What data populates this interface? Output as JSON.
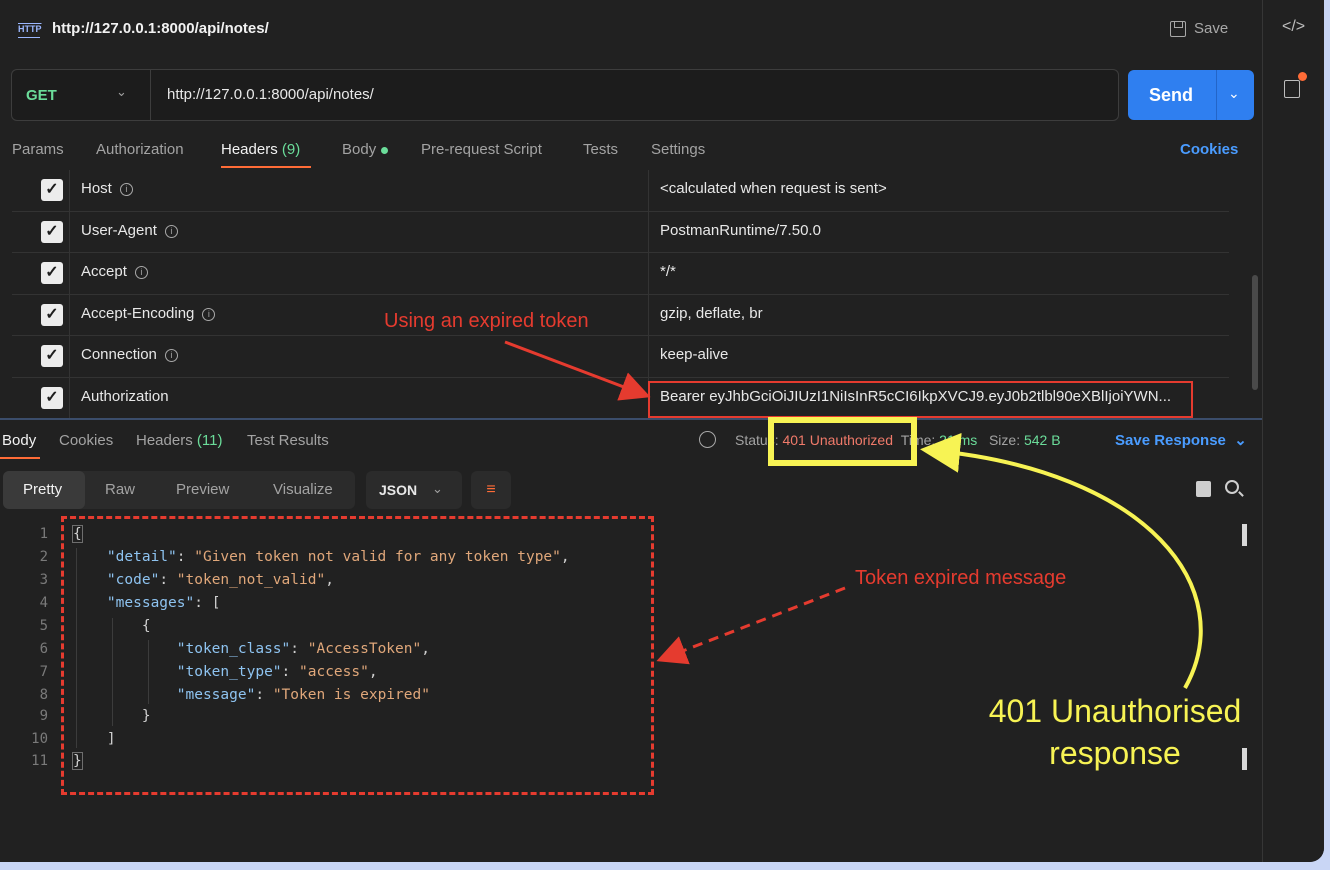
{
  "title_bar": {
    "protocol_badge": "HTTP",
    "title": "http://127.0.0.1:8000/api/notes/",
    "save_label": "Save"
  },
  "request": {
    "method": "GET",
    "url": "http://127.0.0.1:8000/api/notes/",
    "send_label": "Send"
  },
  "request_tabs": [
    {
      "label": "Params"
    },
    {
      "label": "Authorization"
    },
    {
      "label": "Headers",
      "count": "(9)",
      "active": true
    },
    {
      "label": "Body"
    },
    {
      "label": "Pre-request Script"
    },
    {
      "label": "Tests"
    },
    {
      "label": "Settings"
    }
  ],
  "cookies_label": "Cookies",
  "headers": [
    {
      "key": "Host",
      "value": "<calculated when request is sent>",
      "checked": true,
      "info": true
    },
    {
      "key": "User-Agent",
      "value": "PostmanRuntime/7.50.0",
      "checked": true,
      "info": true
    },
    {
      "key": "Accept",
      "value": "*/*",
      "checked": true,
      "info": true
    },
    {
      "key": "Accept-Encoding",
      "value": "gzip, deflate, br",
      "checked": true,
      "info": true
    },
    {
      "key": "Connection",
      "value": "keep-alive",
      "checked": true,
      "info": true
    },
    {
      "key": "Authorization",
      "value": "Bearer eyJhbGciOiJIUzI1NiIsInR5cCI6IkpXVCJ9.eyJ0b2tlbl90eXBlIjoiYWN...",
      "checked": true,
      "info": false
    }
  ],
  "response_tabs": [
    {
      "label": "Body",
      "active": true
    },
    {
      "label": "Cookies"
    },
    {
      "label": "Headers",
      "count": "(11)"
    },
    {
      "label": "Test Results"
    }
  ],
  "response_meta": {
    "status_label": "Status:",
    "status_value": "401 Unauthorized",
    "time_label": "Time:",
    "time_value": "21 ms",
    "size_label": "Size:",
    "size_value": "542 B",
    "save_response_label": "Save Response"
  },
  "view_tabs": [
    "Pretty",
    "Raw",
    "Preview",
    "Visualize"
  ],
  "format": "JSON",
  "code_lines": [
    "1",
    "2",
    "3",
    "4",
    "5",
    "6",
    "7",
    "8",
    "9",
    "10",
    "11"
  ],
  "response_body": {
    "detail_key": "\"detail\"",
    "detail_value": "\"Given token not valid for any token type\"",
    "code_key": "\"code\"",
    "code_value": "\"token_not_valid\"",
    "messages_key": "\"messages\"",
    "token_class_key": "\"token_class\"",
    "token_class_value": "\"AccessToken\"",
    "token_type_key": "\"token_type\"",
    "token_type_value": "\"access\"",
    "message_key": "\"message\"",
    "message_value": "\"Token is expired\""
  },
  "annotations": {
    "expired_token": "Using an expired token",
    "expired_message": "Token expired message",
    "unauthorised_line1": "401 Unauthorised",
    "unauthorised_line2": "response"
  },
  "colors": {
    "accent": "#ff6c37",
    "send_blue": "#2f7ff0",
    "method_green": "#6bdd9a",
    "annotation_red": "#e53b2f",
    "annotation_yellow": "#f7f354"
  },
  "icons": [
    "http-icon",
    "save-icon",
    "code-icon",
    "document-icon",
    "chevron-down-icon",
    "info-icon",
    "globe-icon",
    "wrap-lines-icon",
    "copy-icon",
    "search-icon",
    "checkbox-icon"
  ]
}
